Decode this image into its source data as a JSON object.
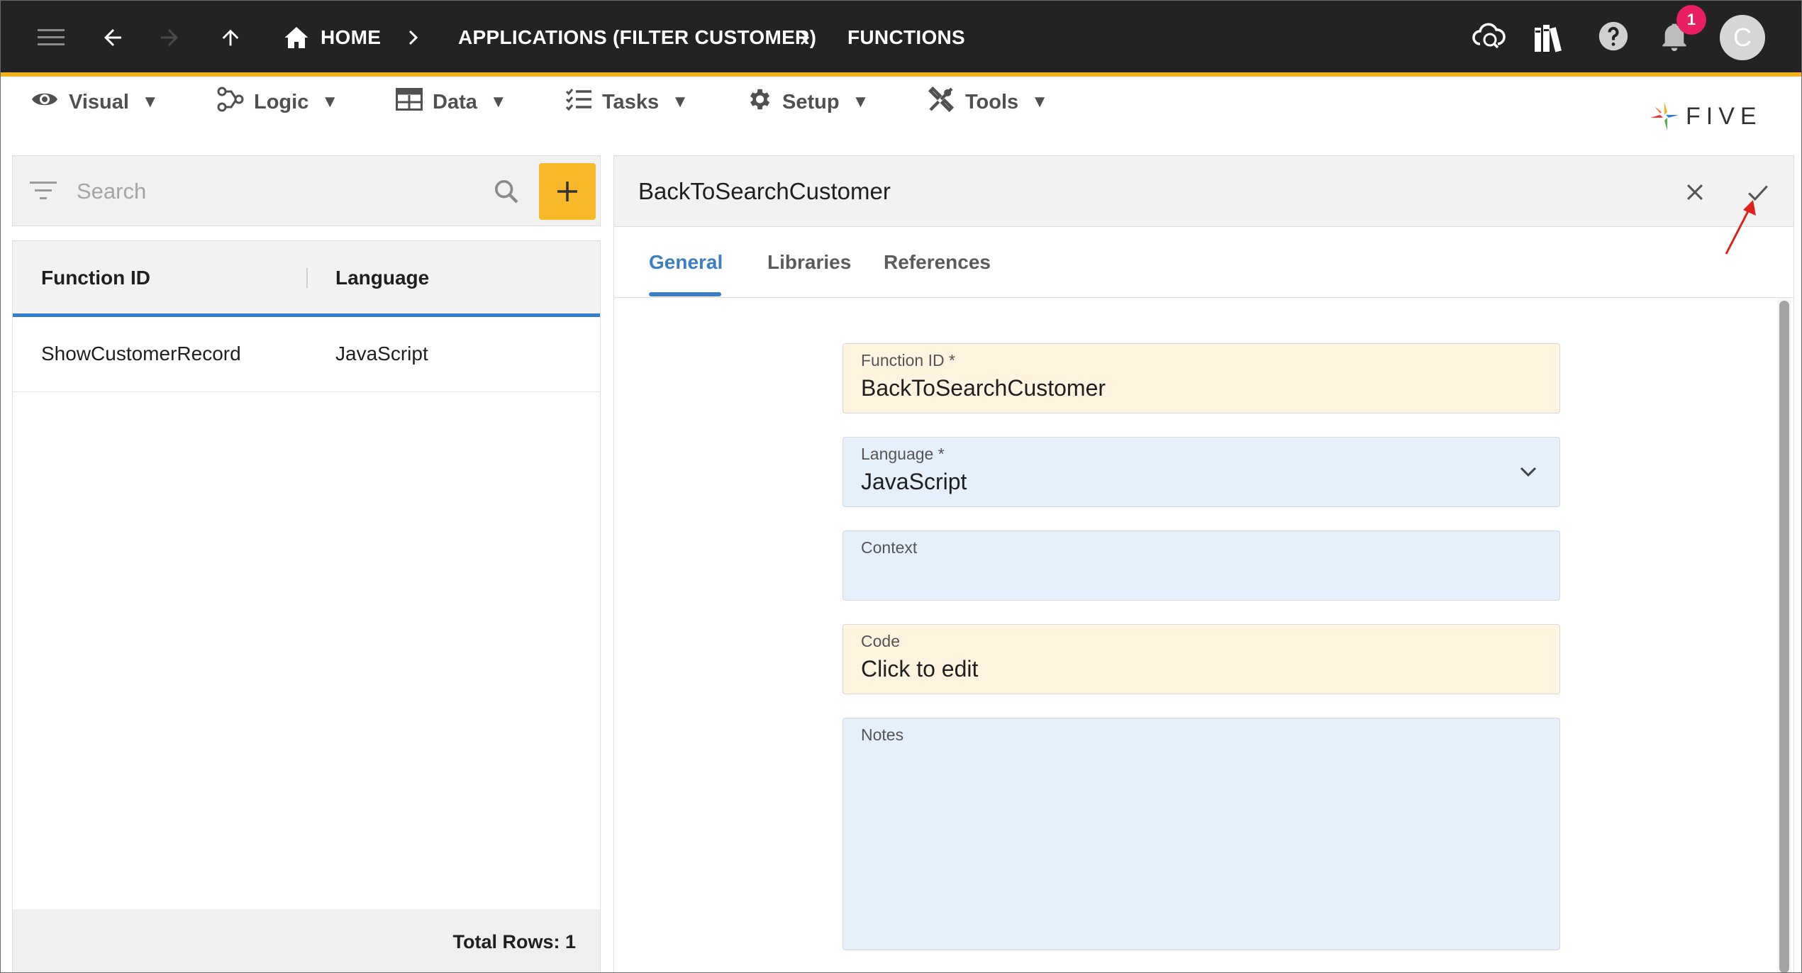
{
  "topbar": {
    "breadcrumbs": [
      "HOME",
      "APPLICATIONS (FILTER CUSTOMER)",
      "FUNCTIONS"
    ],
    "notification_count": "1",
    "avatar_initial": "C"
  },
  "menu": {
    "items": [
      {
        "label": "Visual",
        "icon": "eye-icon"
      },
      {
        "label": "Logic",
        "icon": "logic-icon"
      },
      {
        "label": "Data",
        "icon": "table-icon"
      },
      {
        "label": "Tasks",
        "icon": "tasks-icon"
      },
      {
        "label": "Setup",
        "icon": "gear-icon"
      },
      {
        "label": "Tools",
        "icon": "tools-icon"
      }
    ],
    "dropdown_glyph": "▼",
    "logo_text": "FIVE"
  },
  "search": {
    "placeholder": "Search"
  },
  "list": {
    "columns": [
      "Function ID",
      "Language"
    ],
    "rows": [
      {
        "function_id": "ShowCustomerRecord",
        "language": "JavaScript"
      }
    ],
    "total_rows": "Total Rows: 1"
  },
  "detail": {
    "title": "BackToSearchCustomer",
    "tabs": [
      "General",
      "Libraries",
      "References"
    ],
    "active_tab": "General",
    "fields": {
      "function_id": {
        "label": "Function ID *",
        "value": "BackToSearchCustomer"
      },
      "language": {
        "label": "Language *",
        "value": "JavaScript"
      },
      "context": {
        "label": "Context",
        "value": ""
      },
      "code": {
        "label": "Code",
        "value": "Click to edit"
      },
      "notes": {
        "label": "Notes",
        "value": ""
      }
    }
  },
  "colors": {
    "topbar": "#232323",
    "accent": "#f2b21d",
    "tab_active": "#3a7ec4",
    "required_field": "#fff4df",
    "optional_field": "#e6f0fb",
    "badge": "#e91e63",
    "annotation_arrow": "#e0201b"
  }
}
